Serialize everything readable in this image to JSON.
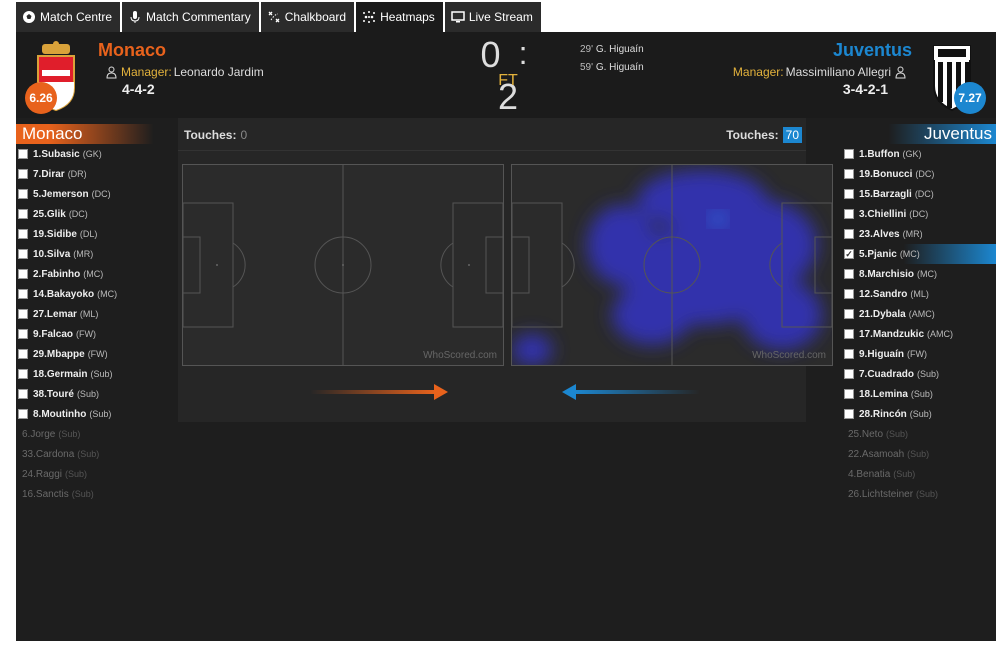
{
  "tabs": [
    {
      "label": "Match Centre",
      "icon": "soccer-ball-icon"
    },
    {
      "label": "Match Commentary",
      "icon": "microphone-icon"
    },
    {
      "label": "Chalkboard",
      "icon": "chalkboard-icon"
    },
    {
      "label": "Heatmaps",
      "icon": "heatmap-dots-icon",
      "active": true
    },
    {
      "label": "Live Stream",
      "icon": "monitor-icon"
    }
  ],
  "home": {
    "name": "Monaco",
    "rating": "6.26",
    "manager_label": "Manager:",
    "manager": "Leonardo Jardim",
    "formation": "4-4-2",
    "color": "#e8621c",
    "touches_label": "Touches:",
    "touches": "0",
    "players": [
      {
        "name": "1.Subasic",
        "pos": "(GK)"
      },
      {
        "name": "7.Dirar",
        "pos": "(DR)"
      },
      {
        "name": "5.Jemerson",
        "pos": "(DC)"
      },
      {
        "name": "25.Glik",
        "pos": "(DC)"
      },
      {
        "name": "19.Sidibe",
        "pos": "(DL)"
      },
      {
        "name": "10.Silva",
        "pos": "(MR)"
      },
      {
        "name": "2.Fabinho",
        "pos": "(MC)"
      },
      {
        "name": "14.Bakayoko",
        "pos": "(MC)"
      },
      {
        "name": "27.Lemar",
        "pos": "(ML)"
      },
      {
        "name": "9.Falcao",
        "pos": "(FW)"
      },
      {
        "name": "29.Mbappe",
        "pos": "(FW)"
      },
      {
        "name": "18.Germain",
        "pos": "(Sub)"
      },
      {
        "name": "38.Touré",
        "pos": "(Sub)"
      },
      {
        "name": "8.Moutinho",
        "pos": "(Sub)"
      }
    ],
    "unused": [
      {
        "name": "6.Jorge",
        "pos": "(Sub)"
      },
      {
        "name": "33.Cardona",
        "pos": "(Sub)"
      },
      {
        "name": "24.Raggi",
        "pos": "(Sub)"
      },
      {
        "name": "16.Sanctis",
        "pos": "(Sub)"
      }
    ]
  },
  "away": {
    "name": "Juventus",
    "rating": "7.27",
    "manager_label": "Manager:",
    "manager": "Massimiliano Allegri",
    "formation": "3-4-2-1",
    "color": "#1c87d0",
    "touches_label": "Touches:",
    "touches": "70",
    "players": [
      {
        "name": "1.Buffon",
        "pos": "(GK)"
      },
      {
        "name": "19.Bonucci",
        "pos": "(DC)"
      },
      {
        "name": "15.Barzagli",
        "pos": "(DC)"
      },
      {
        "name": "3.Chiellini",
        "pos": "(DC)"
      },
      {
        "name": "23.Alves",
        "pos": "(MR)"
      },
      {
        "name": "5.Pjanic",
        "pos": "(MC)",
        "checked": true
      },
      {
        "name": "8.Marchisio",
        "pos": "(MC)"
      },
      {
        "name": "12.Sandro",
        "pos": "(ML)"
      },
      {
        "name": "21.Dybala",
        "pos": "(AMC)"
      },
      {
        "name": "17.Mandzukic",
        "pos": "(AMC)"
      },
      {
        "name": "9.Higuaín",
        "pos": "(FW)"
      },
      {
        "name": "7.Cuadrado",
        "pos": "(Sub)"
      },
      {
        "name": "18.Lemina",
        "pos": "(Sub)"
      },
      {
        "name": "28.Rincón",
        "pos": "(Sub)"
      }
    ],
    "unused": [
      {
        "name": "25.Neto",
        "pos": "(Sub)"
      },
      {
        "name": "22.Asamoah",
        "pos": "(Sub)"
      },
      {
        "name": "4.Benatia",
        "pos": "(Sub)"
      },
      {
        "name": "26.Lichtsteiner",
        "pos": "(Sub)"
      }
    ]
  },
  "score": {
    "home": "0",
    "sep": ":",
    "away": "2",
    "status": "FT"
  },
  "goals": [
    {
      "minute": "29'",
      "scorer": "G. Higuaín"
    },
    {
      "minute": "59'",
      "scorer": "G. Higuaín"
    }
  ],
  "watermark": "WhoScored.com",
  "colors": {
    "home": "#e8621c",
    "away": "#1c87d0",
    "manager_label": "#e3b23c",
    "heat": "#3a3ae6"
  }
}
